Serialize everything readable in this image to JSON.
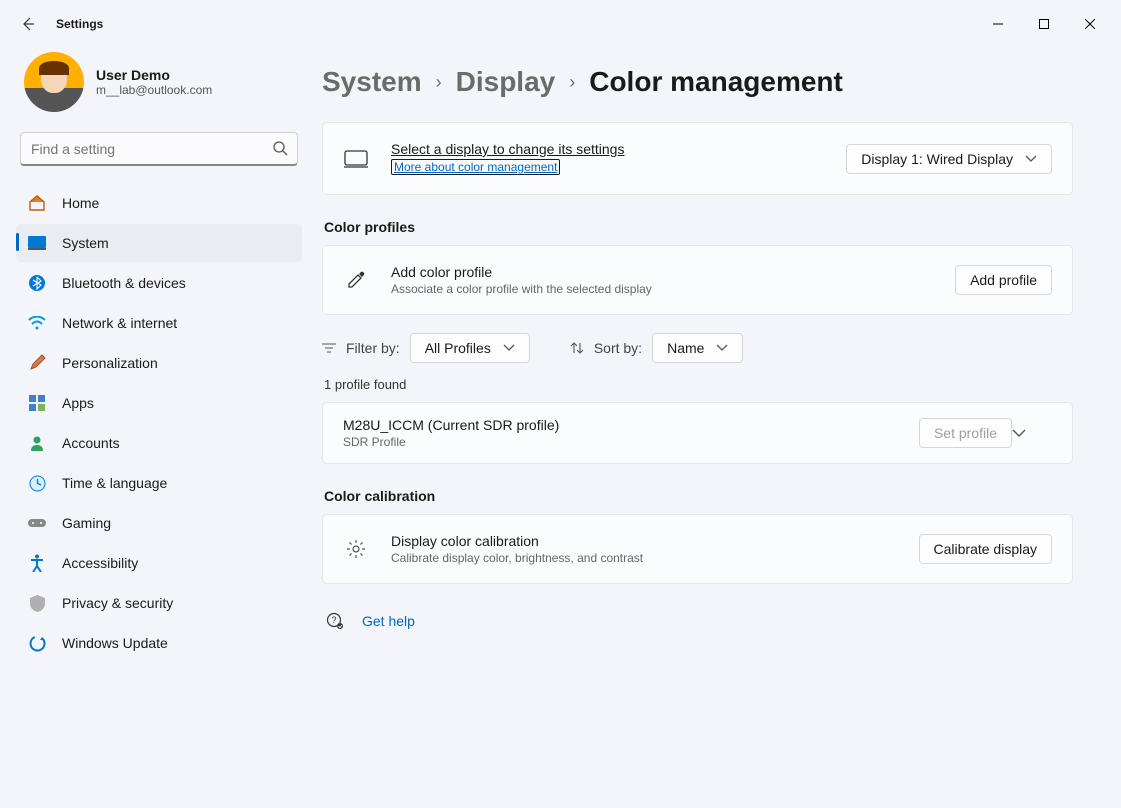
{
  "app_title": "Settings",
  "user": {
    "name": "User Demo",
    "email": "m__lab@outlook.com"
  },
  "search": {
    "placeholder": "Find a setting"
  },
  "nav": {
    "home": "Home",
    "system": "System",
    "bluetooth": "Bluetooth & devices",
    "network": "Network & internet",
    "personalization": "Personalization",
    "apps": "Apps",
    "accounts": "Accounts",
    "time": "Time & language",
    "gaming": "Gaming",
    "accessibility": "Accessibility",
    "privacy": "Privacy & security",
    "update": "Windows Update"
  },
  "breadcrumbs": {
    "a": "System",
    "b": "Display",
    "c": "Color management"
  },
  "display_select": {
    "title": "Select a display to change its settings",
    "link": "More about color management",
    "value": "Display 1: Wired Display"
  },
  "sections": {
    "profiles": "Color profiles",
    "calibration": "Color calibration"
  },
  "add_profile": {
    "title": "Add color profile",
    "sub": "Associate a color profile with the selected display",
    "button": "Add profile"
  },
  "filter": {
    "filter_label": "Filter by:",
    "filter_value": "All Profiles",
    "sort_label": "Sort by:",
    "sort_value": "Name"
  },
  "found_text": "1 profile found",
  "profile": {
    "name": "M28U_ICCM (Current SDR profile)",
    "type": "SDR Profile",
    "set_button": "Set profile"
  },
  "calibration": {
    "title": "Display color calibration",
    "sub": "Calibrate display color, brightness, and contrast",
    "button": "Calibrate display"
  },
  "help": "Get help"
}
